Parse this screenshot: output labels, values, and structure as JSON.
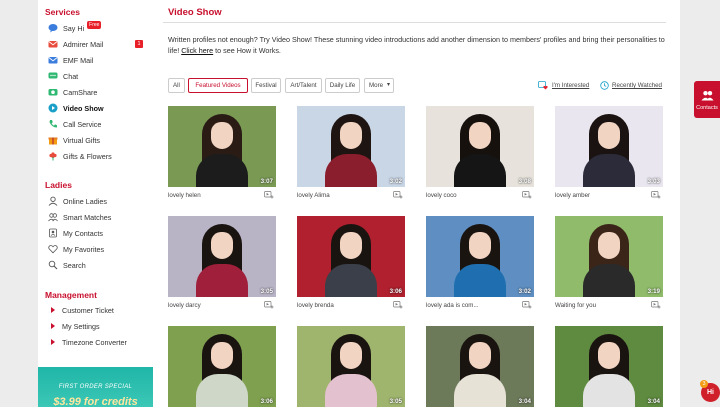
{
  "sidebar": {
    "services_title": "Services",
    "services": [
      {
        "label": "Say Hi",
        "icon": "chat-bubble-icon",
        "badge": "Free"
      },
      {
        "label": "Admirer Mail",
        "icon": "envelope-icon",
        "count": "1"
      },
      {
        "label": "EMF Mail",
        "icon": "mail-icon"
      },
      {
        "label": "Chat",
        "icon": "chat-icon"
      },
      {
        "label": "CamShare",
        "icon": "camera-icon"
      },
      {
        "label": "Video Show",
        "icon": "video-icon",
        "active": true
      },
      {
        "label": "Call Service",
        "icon": "phone-icon"
      },
      {
        "label": "Virtual Gifts",
        "icon": "gift-icon"
      },
      {
        "label": "Gifts & Flowers",
        "icon": "flower-icon"
      }
    ],
    "ladies_title": "Ladies",
    "ladies": [
      {
        "label": "Online Ladies",
        "icon": "person-icon"
      },
      {
        "label": "Smart Matches",
        "icon": "matches-icon"
      },
      {
        "label": "My Contacts",
        "icon": "contacts-icon"
      },
      {
        "label": "My Favorites",
        "icon": "heart-icon"
      },
      {
        "label": "Search",
        "icon": "search-icon"
      }
    ],
    "management_title": "Management",
    "management": [
      {
        "label": "Customer Ticket"
      },
      {
        "label": "My Settings"
      },
      {
        "label": "Timezone Converter"
      }
    ],
    "promo_line1": "FIRST ORDER SPECIAL",
    "promo_line2": "$3.99 for credits"
  },
  "main": {
    "title": "Video Show",
    "intro_text": "Written profiles not enough? Try Video Show! These stunning video introductions add another dimension to members' profiles and bring their personalities to life!",
    "intro_link": "Click here",
    "intro_tail": "to see How it Works.",
    "tabs": [
      "All",
      "Featured Videos",
      "Festival",
      "Art/Talent",
      "Daily Life",
      "More"
    ],
    "active_tab": "Featured Videos",
    "im_interested": "I'm Interested",
    "recently_watched": "Recently Watched"
  },
  "videos": [
    {
      "name": "lovely helen",
      "duration": "3:07",
      "bg": "#7a9a54",
      "hair": "#2a1c15",
      "outfit": "#1c1c1c"
    },
    {
      "name": "lovely Alima",
      "duration": "3:02",
      "bg": "#c9d6e6",
      "hair": "#1e1512",
      "outfit": "#8b1e2d"
    },
    {
      "name": "lovely coco",
      "duration": "3:08",
      "bg": "#e7e3dc",
      "hair": "#17110e",
      "outfit": "#151515"
    },
    {
      "name": "lovely amber",
      "duration": "3:03",
      "bg": "#e9e6ef",
      "hair": "#1a1311",
      "outfit": "#2b2b3a"
    },
    {
      "name": "lovely darcy",
      "duration": "3:05",
      "bg": "#b9b3c6",
      "hair": "#1a1411",
      "outfit": "#a01f3a"
    },
    {
      "name": "lovely brenda",
      "duration": "3:06",
      "bg": "#b0202e",
      "hair": "#1a1411",
      "outfit": "#3b3f4a"
    },
    {
      "name": "lovely ada is com...",
      "duration": "3:02",
      "bg": "#5f8fc2",
      "hair": "#1a1411",
      "outfit": "#1f6fb0"
    },
    {
      "name": "Waiting for you",
      "duration": "3:19",
      "bg": "#8fbb6a",
      "hair": "#3a2518",
      "outfit": "#2a2a2a"
    },
    {
      "name": "",
      "duration": "3:06",
      "bg": "#7fa14f",
      "hair": "#1a1411",
      "outfit": "#cfd8c8"
    },
    {
      "name": "",
      "duration": "3:05",
      "bg": "#9fb56e",
      "hair": "#1a1411",
      "outfit": "#e4c1cf"
    },
    {
      "name": "",
      "duration": "3:04",
      "bg": "#6d7a5a",
      "hair": "#1a1411",
      "outfit": "#e6e2d6"
    },
    {
      "name": "",
      "duration": "3:04",
      "bg": "#5e8b3f",
      "hair": "#1a1411",
      "outfit": "#e3e3e3"
    }
  ],
  "widgets": {
    "contacts_label": "Contacts",
    "hi_label": "Hi",
    "hi_count": "3"
  },
  "colors": {
    "accent": "#c8102e"
  }
}
